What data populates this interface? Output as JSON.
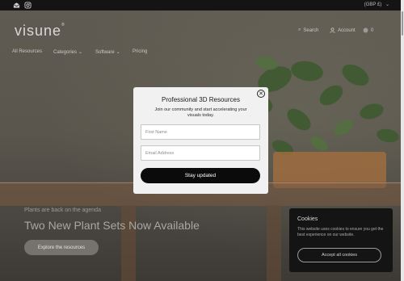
{
  "topbar": {
    "currency": "(GBP £)",
    "icons": [
      "email-icon",
      "instagram-icon"
    ]
  },
  "header": {
    "logo": "visune",
    "logo_mark": "®",
    "search_label": "Search",
    "account_label": "Account",
    "cart_count": "0"
  },
  "nav": [
    {
      "label": "All Resources",
      "dropdown": false
    },
    {
      "label": "Categories",
      "dropdown": true
    },
    {
      "label": "Software",
      "dropdown": true
    },
    {
      "label": "Pricing",
      "dropdown": false
    }
  ],
  "hero": {
    "kicker": "Plants are back on the agenda",
    "title": "Two New Plant Sets Now Available",
    "button": "Explore the resources"
  },
  "modal": {
    "title": "Professional 3D Resources",
    "description": "Join our community and start accelerating your visuals today.",
    "first_name_placeholder": "First Name",
    "email_placeholder": "Email Address",
    "submit": "Stay updated",
    "close_glyph": "✕"
  },
  "cookies": {
    "title": "Cookies",
    "text": "This website uses cookies to ensure you get the best experience on our website.",
    "accept": "Accept all cookies"
  },
  "colors": {
    "overlay_bg": "#5a564d",
    "modal_bg": "#f1f1f1",
    "button_dark": "#0b0b0b",
    "cookie_bg": "#141414"
  }
}
